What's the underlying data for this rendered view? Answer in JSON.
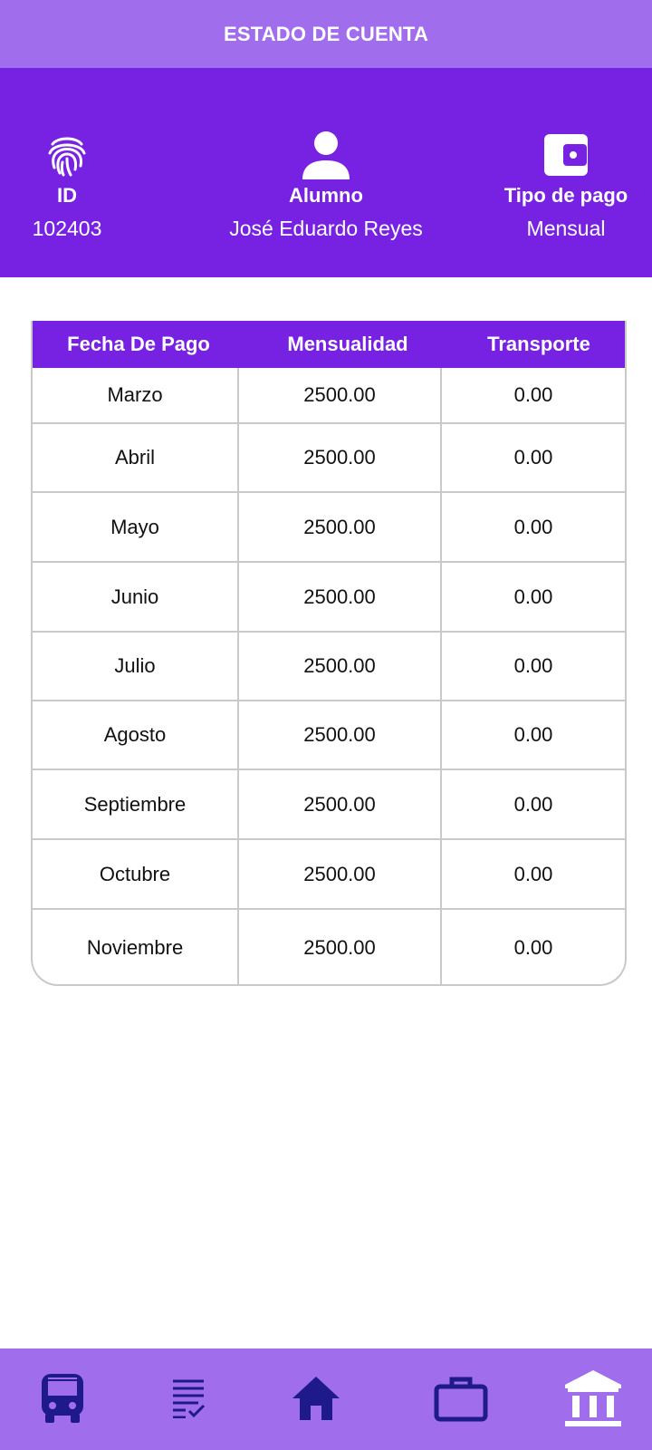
{
  "header": {
    "title": "ESTADO DE CUENTA"
  },
  "info": {
    "id": {
      "icon": "fingerprint-icon",
      "label": "ID",
      "value": "102403"
    },
    "alumno": {
      "icon": "person-icon",
      "label": "Alumno",
      "value": "José Eduardo Reyes"
    },
    "tipo_pago": {
      "icon": "wallet-icon",
      "label": "Tipo de pago",
      "value": "Mensual"
    }
  },
  "table": {
    "headers": [
      "Fecha De Pago",
      "Mensualidad",
      "Transporte"
    ],
    "rows": [
      [
        "Marzo",
        "2500.00",
        "0.00"
      ],
      [
        "Abril",
        "2500.00",
        "0.00"
      ],
      [
        "Mayo",
        "2500.00",
        "0.00"
      ],
      [
        "Junio",
        "2500.00",
        "0.00"
      ],
      [
        "Julio",
        "2500.00",
        "0.00"
      ],
      [
        "Agosto",
        "2500.00",
        "0.00"
      ],
      [
        "Septiembre",
        "2500.00",
        "0.00"
      ],
      [
        "Octubre",
        "2500.00",
        "0.00"
      ],
      [
        "Noviembre",
        "2500.00",
        "0.00"
      ]
    ]
  },
  "bottom_nav": {
    "items": [
      {
        "icon": "bus-icon"
      },
      {
        "icon": "checklist-icon"
      },
      {
        "icon": "home-icon"
      },
      {
        "icon": "briefcase-icon"
      },
      {
        "icon": "bank-icon",
        "active": true
      }
    ]
  },
  "colors": {
    "topbar": "#a06ded",
    "band": "#7722e3",
    "nav_icon": "#1e1a8c",
    "nav_icon_active": "#ffffff"
  }
}
